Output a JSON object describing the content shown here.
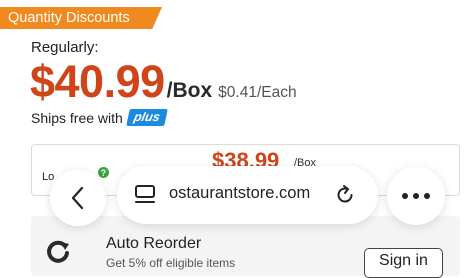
{
  "badge": {
    "label": "Quantity Discounts",
    "color": "#f08a1e"
  },
  "pricing": {
    "regularly_label": "Regularly:",
    "price": "$40.99",
    "unit": "/Box",
    "each": "$0.41/Each",
    "price_color": "#cf4418"
  },
  "shipping": {
    "text": "Ships free with",
    "plus_label": "plus",
    "plus_color": "#1b8be0"
  },
  "lot": {
    "label": "Lo",
    "help_icon": "question-circle-icon",
    "price": "$38.99",
    "unit": "/Box"
  },
  "auto_reorder": {
    "icon": "reorder-refresh-icon",
    "title": "Auto Reorder",
    "subtitle": "Get 5% off eligible items",
    "sign_in_label": "Sign in"
  },
  "browser": {
    "back_icon": "chevron-left-icon",
    "tab_icon": "tabs-icon",
    "url": "ostaurantstore.com",
    "reload_icon": "reload-icon",
    "more_icon": "ellipsis-icon"
  }
}
